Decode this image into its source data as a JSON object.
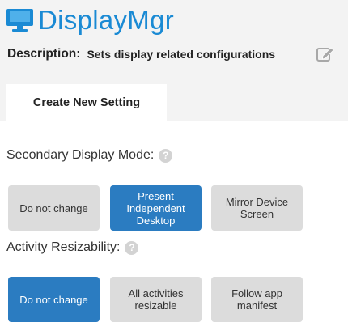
{
  "header": {
    "app_title": "DisplayMgr",
    "description_label": "Description:",
    "description_value": "Sets display related configurations",
    "edit_icon": "pencil-edit-icon",
    "app_icon": "monitor-icon",
    "accent_color": "#1a8ad4"
  },
  "tabs": [
    {
      "label": "Create New Setting",
      "selected": true
    }
  ],
  "settings": {
    "secondary_display_mode": {
      "label": "Secondary Display Mode:",
      "help_icon": "question-mark-icon",
      "help_glyph": "?",
      "options": [
        {
          "label": "Do not change",
          "selected": false
        },
        {
          "label": "Present Independent Desktop",
          "selected": true
        },
        {
          "label": "Mirror Device Screen",
          "selected": false
        }
      ]
    },
    "activity_resizability": {
      "label": "Activity Resizability:",
      "help_icon": "question-mark-icon",
      "help_glyph": "?",
      "options": [
        {
          "label": "Do not change",
          "selected": true
        },
        {
          "label": "All activities resizable",
          "selected": false
        },
        {
          "label": "Follow app manifest",
          "selected": false
        }
      ]
    }
  },
  "colors": {
    "selected_button": "#2b7cc1",
    "unselected_button": "#dcdcdc",
    "header_background": "#f3f3f3"
  }
}
